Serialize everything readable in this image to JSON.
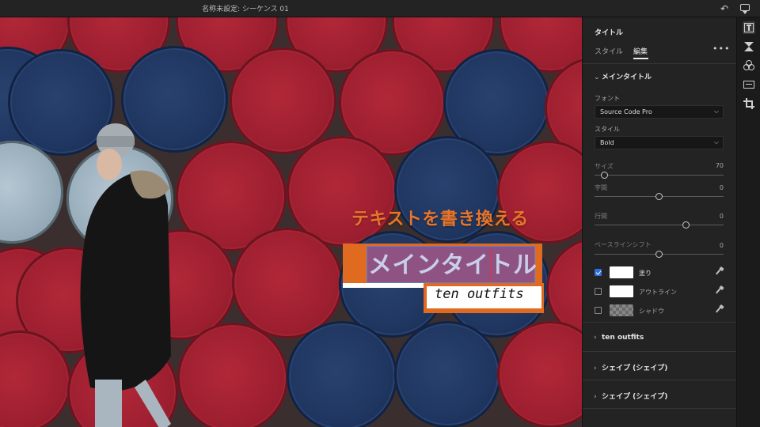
{
  "window": {
    "title": "名称未設定: シーケンス 01"
  },
  "overlay": {
    "headline": "テキストを書き換える",
    "main_title": "メインタイトル",
    "subtitle": "ten outfits",
    "accent_color": "#e06a1f",
    "selection_color": "#8f5383"
  },
  "panel": {
    "title": "タイトル",
    "tabs": [
      {
        "label": "スタイル",
        "active": false
      },
      {
        "label": "編集",
        "active": true
      }
    ],
    "more_label": "•••",
    "sections": {
      "main_title_header": "メインタイトル",
      "ten_outfits_header": "ten outfits",
      "shape1_header": "シェイプ (シェイプ)",
      "shape2_header": "シェイプ (シェイプ)"
    },
    "font_label": "フォント",
    "font_value": "Source Code Pro",
    "style_label": "スタイル",
    "style_value": "Bold",
    "size": {
      "label": "サイズ",
      "value": "70",
      "level": 0.05
    },
    "tracking": {
      "label": "字間",
      "value": "0",
      "level": 0.5
    },
    "leading": {
      "label": "行間",
      "value": "0",
      "level": 0.72
    },
    "baseline": {
      "label": "ベースラインシフト",
      "value": "0",
      "level": 0.5
    },
    "appearance": [
      {
        "label": "塗り",
        "checked": true,
        "swatch": "white"
      },
      {
        "label": "アウトライン",
        "checked": false,
        "swatch": "white"
      },
      {
        "label": "シャドウ",
        "checked": false,
        "swatch": "checker"
      }
    ]
  },
  "icons": {
    "undo": "undo-icon",
    "feedback": "chat-bubble-icon",
    "tools": [
      "essential-graphics-icon",
      "transitions-icon",
      "color-icon",
      "audio-icon",
      "crop-icon"
    ]
  }
}
